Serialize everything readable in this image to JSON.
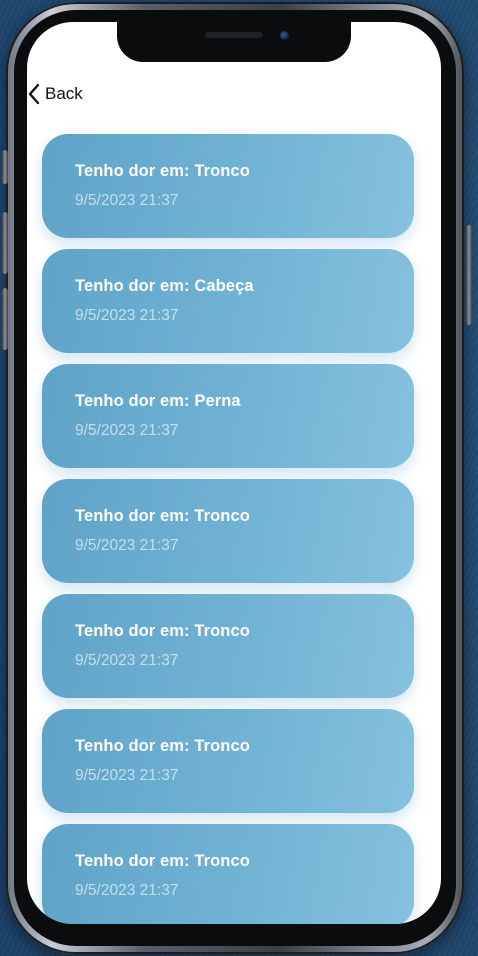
{
  "navigation": {
    "back_label": "Back"
  },
  "records": [
    {
      "title": "Tenho dor em: Tronco",
      "datetime": "9/5/2023 21:37"
    },
    {
      "title": "Tenho dor em: Cabeça",
      "datetime": "9/5/2023 21:37"
    },
    {
      "title": "Tenho dor em: Perna",
      "datetime": "9/5/2023 21:37"
    },
    {
      "title": "Tenho dor em: Tronco",
      "datetime": "9/5/2023 21:37"
    },
    {
      "title": "Tenho dor em: Tronco",
      "datetime": "9/5/2023 21:37"
    },
    {
      "title": "Tenho dor em: Tronco",
      "datetime": "9/5/2023 21:37"
    },
    {
      "title": "Tenho dor em: Tronco",
      "datetime": "9/5/2023 21:37"
    }
  ],
  "colors": {
    "card_start": "#5fa3c8",
    "card_end": "#86c1de",
    "background": "#24507a"
  }
}
